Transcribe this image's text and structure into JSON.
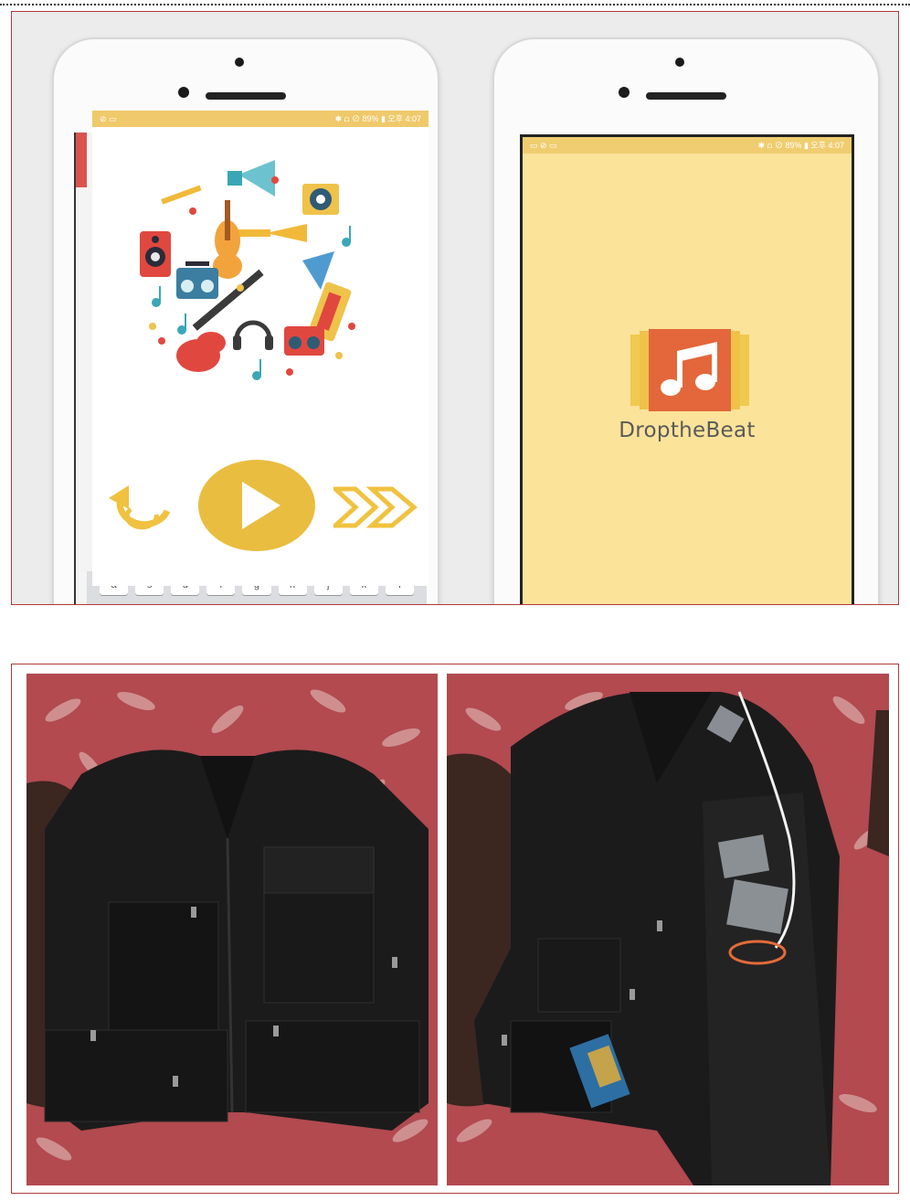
{
  "phone_left": {
    "status_bar": {
      "left_icons": "⊘ ▭",
      "right_text": "✱ ⩍ ⊘ 89% ▮ 오후 4:07"
    },
    "controls": {
      "rewind_icon": "rewind-icon",
      "play_icon": "play-icon",
      "forward_icon": "fast-forward-icon"
    },
    "keyboard_keys": [
      "a",
      "s",
      "d",
      "f",
      "g",
      "h",
      "j",
      "k",
      "l"
    ]
  },
  "phone_right": {
    "status_bar": {
      "left_icons": "▭ ⊘ ▭",
      "right_text": "✱ ⩍ ⊘ 89% ▮ 오후 4:07"
    },
    "app_name": "DroptheBeat",
    "logo_icon": "music-note-icon"
  },
  "colors": {
    "accent_yellow": "#e9bd3f",
    "app_background": "#fbe39a",
    "logo_orange": "#e0693a",
    "frame_border": "#b03a3a",
    "carpet": "#b44a4f",
    "vest": "#1c1b1b"
  },
  "photos": {
    "left": "vest-front-closed-photo",
    "right": "vest-open-with-electronics-photo"
  }
}
